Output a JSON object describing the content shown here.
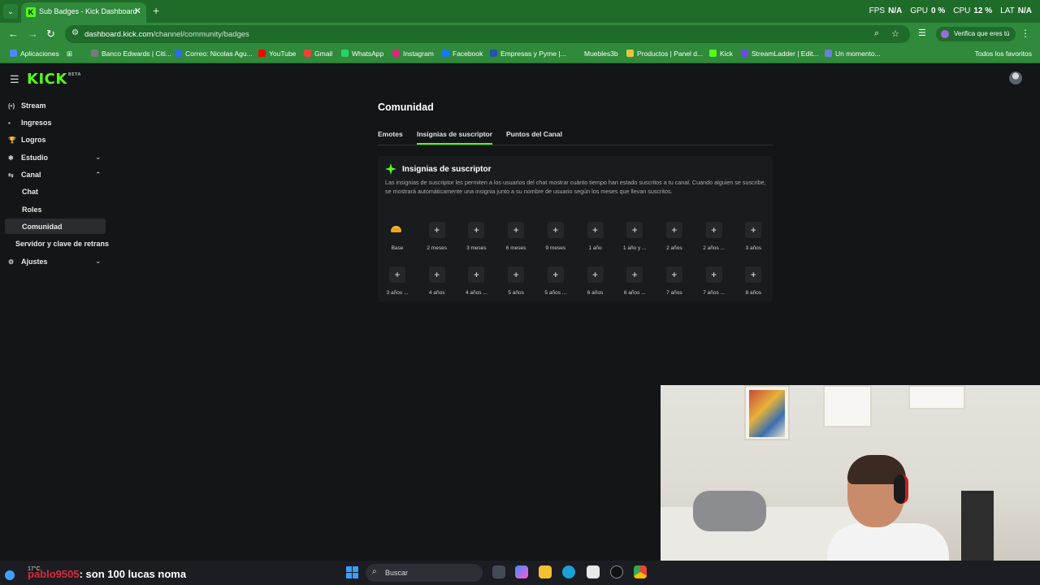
{
  "browser": {
    "tab_title": "Sub Badges - Kick Dashboard",
    "tab_close": "✕",
    "new_tab": "+",
    "url_domain": "dashboard.kick.com",
    "url_path": "/channel/community/badges",
    "profile_label": "Verifica que eres tú",
    "stats": [
      {
        "label": "FPS",
        "value": "N/A"
      },
      {
        "label": "GPU",
        "value": "0 %"
      },
      {
        "label": "CPU",
        "value": "12 %"
      },
      {
        "label": "LAT",
        "value": "N/A"
      }
    ],
    "bookmarks": [
      {
        "label": "Aplicaciones",
        "color": "#4b8bf5"
      },
      {
        "label": "Banco Edwards | Citi...",
        "color": "#7a7a7a"
      },
      {
        "label": "Correo: Nicolas Agu...",
        "color": "#2b6fd8"
      },
      {
        "label": "YouTube",
        "color": "#ff0000"
      },
      {
        "label": "Gmail",
        "color": "#ea4335"
      },
      {
        "label": "WhatsApp",
        "color": "#25d366"
      },
      {
        "label": "Instagram",
        "color": "#d62976"
      },
      {
        "label": "Facebook",
        "color": "#1877f2"
      },
      {
        "label": "Empresas y Pyme |...",
        "color": "#2553a8"
      },
      {
        "label": "Muebles3b",
        "color": "#2f8a3b"
      },
      {
        "label": "Productos | Panel d...",
        "color": "#e8c83a"
      },
      {
        "label": "Kick",
        "color": "#53fc18"
      },
      {
        "label": "StreamLadder | Edit...",
        "color": "#6b4be0"
      },
      {
        "label": "Un momento...",
        "color": "#6d7fd8"
      }
    ],
    "all_bookmarks": "Todos los favoritos"
  },
  "app": {
    "logo": "KICK",
    "logo_badge": "BETA",
    "sidebar": {
      "items": [
        {
          "label": "Stream",
          "icon": "(•)"
        },
        {
          "label": "Ingresos",
          "icon": "▪"
        },
        {
          "label": "Logros",
          "icon": "🏆"
        },
        {
          "label": "Estudio",
          "icon": "✱"
        },
        {
          "label": "Canal",
          "icon": "⇆"
        }
      ],
      "sub_items": [
        "Chat",
        "Roles",
        "Comunidad"
      ],
      "extra": "Servidor y clave de retrans",
      "settings": "Ajustes"
    },
    "page_title": "Comunidad",
    "tabs": [
      "Emotes",
      "Insignias de suscriptor",
      "Puntos del Canal"
    ],
    "card": {
      "title": "Insignias de suscriptor",
      "description": "Las insignias de suscriptor les permiten a los usuarios del chat mostrar cuánto tiempo han estado suscritos a tu canal. Cuando alguien se suscribe, se mostrará automáticamente una insignia junto a su nombre de usuario según los meses que llevan suscritos."
    },
    "badges_row1": [
      "Base",
      "2 meses",
      "3 meses",
      "6 meses",
      "9 meses",
      "1 año",
      "1 año y ...",
      "2 años",
      "2 años ...",
      "3 años"
    ],
    "badges_row2": [
      "3 años ...",
      "4 años",
      "4 años ...",
      "5 años",
      "5 años ...",
      "6 años",
      "6 años ...",
      "7 años",
      "7 años ...",
      "8 años"
    ],
    "add_symbol": "+",
    "accent": "#53fc18"
  },
  "taskbar": {
    "temperature": "17°C",
    "chat_user": "pablo9505",
    "chat_message": ": son 100 lucas noma",
    "search_placeholder": "Buscar"
  }
}
